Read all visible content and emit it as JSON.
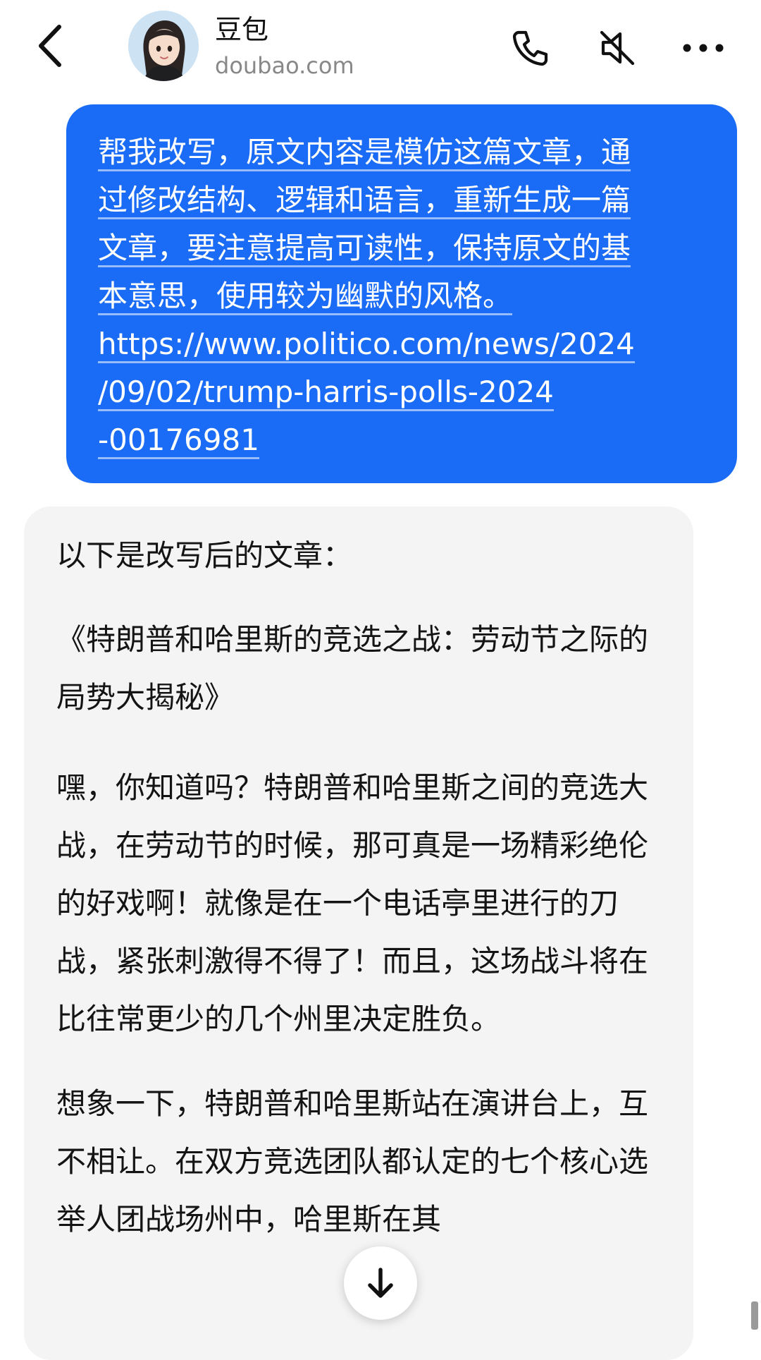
{
  "header": {
    "contact_name": "豆包",
    "contact_sub": "doubao.com",
    "icons": [
      "back-arrow-icon",
      "phone-icon",
      "speaker-muted-icon",
      "more-dots-icon"
    ]
  },
  "messages": {
    "user": {
      "line1": "帮我改写，原文内容是模仿这篇文章，通",
      "line2": "过修改结构、逻辑和语言，重新生成一篇",
      "line3": "文章，要注意提高可读性，保持原文的基",
      "line4": "本意思，使用较为幽默的风格。",
      "url1": "https://www.politico.com/news/2024",
      "url2": "/09/02/trump-harris-polls-2024",
      "url3": "-00176981"
    },
    "assistant": {
      "intro": "以下是改写后的文章：",
      "title": "《特朗普和哈里斯的竞选之战：劳动节之际的局势大揭秘》",
      "para1": "嘿，你知道吗？特朗普和哈里斯之间的竞选大战，在劳动节的时候，那可真是一场精彩绝伦的好戏啊！就像是在一个电话亭里进行的刀战，紧张刺激得不得了！而且，这场战斗将在比往常更少的几个州里决定胜负。",
      "para2": "想象一下，特朗普和哈里斯站在演讲台上，互不相让。在双方竞选团队都认定的七个核心选举人团战场州中，哈里斯在其"
    }
  },
  "colors": {
    "user_bubble": "#1a6bf5",
    "bot_bubble": "#f4f4f5",
    "muted_text": "#888888"
  }
}
